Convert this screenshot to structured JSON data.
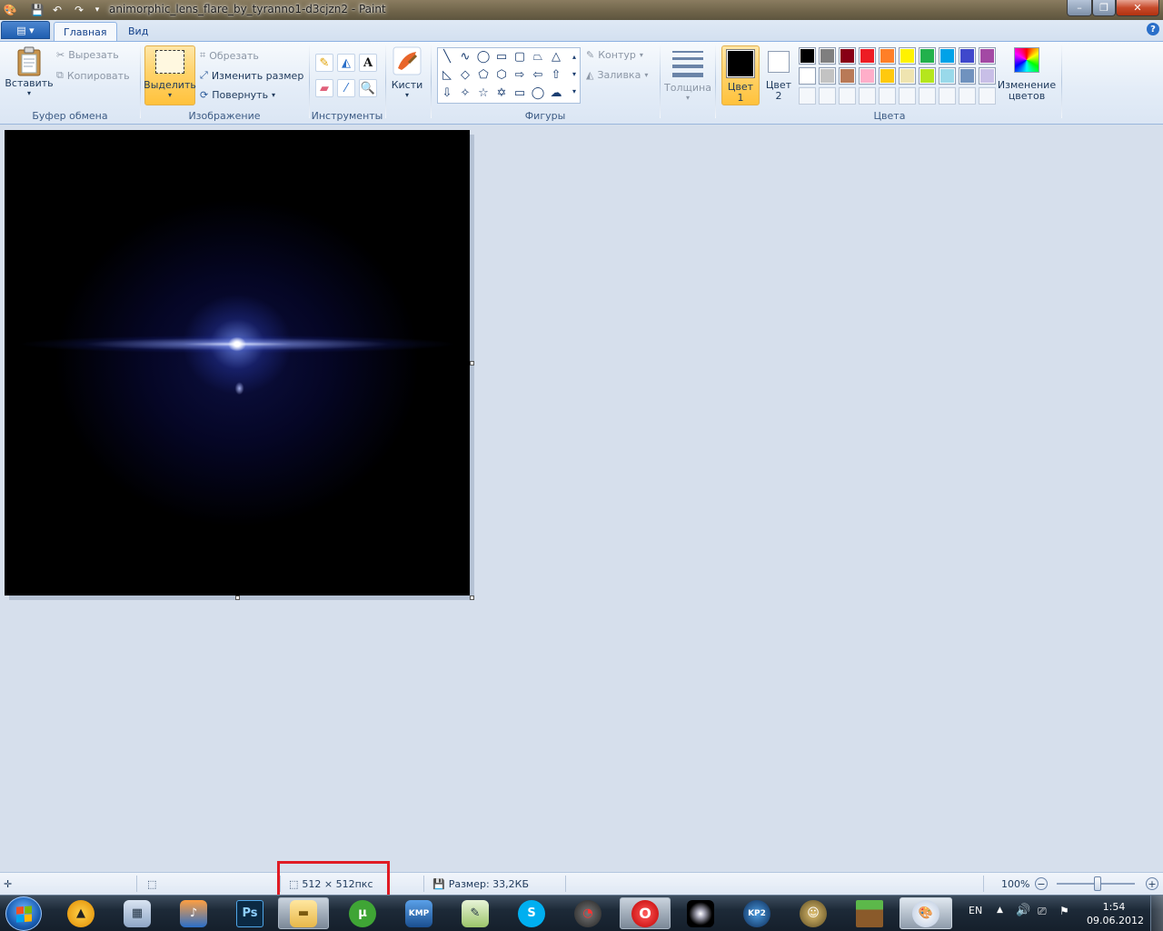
{
  "window": {
    "title": "animorphic_lens_flare_by_tyranno1-d3cjzn2 - Paint",
    "minimize": "–",
    "maximize": "❐",
    "close": "✕"
  },
  "tabs": {
    "file_menu": "▤ ▾",
    "home": "Главная",
    "view": "Вид",
    "help": "?"
  },
  "ribbon": {
    "clipboard": {
      "group": "Буфер обмена",
      "paste": "Вставить",
      "cut": "Вырезать",
      "copy": "Копировать"
    },
    "image": {
      "group": "Изображение",
      "select": "Выделить",
      "crop": "Обрезать",
      "resize": "Изменить размер",
      "rotate": "Повернуть"
    },
    "tools": {
      "group": "Инструменты"
    },
    "brushes": {
      "label": "Кисти"
    },
    "shapes": {
      "group": "Фигуры",
      "outline": "Контур",
      "fill": "Заливка"
    },
    "thickness": {
      "label": "Толщина"
    },
    "colors": {
      "group": "Цвета",
      "color1_line1": "Цвет",
      "color1_line2": "1",
      "color2_line1": "Цвет",
      "color2_line2": "2",
      "edit_line1": "Изменение",
      "edit_line2": "цветов",
      "color1_value": "#000000",
      "color2_value": "#ffffff",
      "palette_row1": [
        "#000000",
        "#7f7f7f",
        "#880015",
        "#ed1c24",
        "#ff7f27",
        "#fff200",
        "#22b14c",
        "#00a2e8",
        "#3f48cc",
        "#a349a4"
      ],
      "palette_row2": [
        "#ffffff",
        "#c3c3c3",
        "#b97a57",
        "#ffaec9",
        "#ffc90e",
        "#efe4b0",
        "#b5e61d",
        "#99d9ea",
        "#7092be",
        "#c8bfe7"
      ]
    }
  },
  "statusbar": {
    "dimensions": "512 × 512пкс",
    "filesize": "Размер: 33,2КБ",
    "zoom": "100%",
    "zoom_level_percent": 100
  },
  "taskbar": {
    "apps": [
      "aimp",
      "calculator",
      "media",
      "photoshop",
      "explorer",
      "utorrent",
      "kmplayer",
      "notepad",
      "skype",
      "speedometer",
      "opera",
      "star",
      "kp2",
      "character",
      "minecraft",
      "paint"
    ],
    "language": "EN",
    "time": "1:54",
    "date": "09.06.2012"
  }
}
